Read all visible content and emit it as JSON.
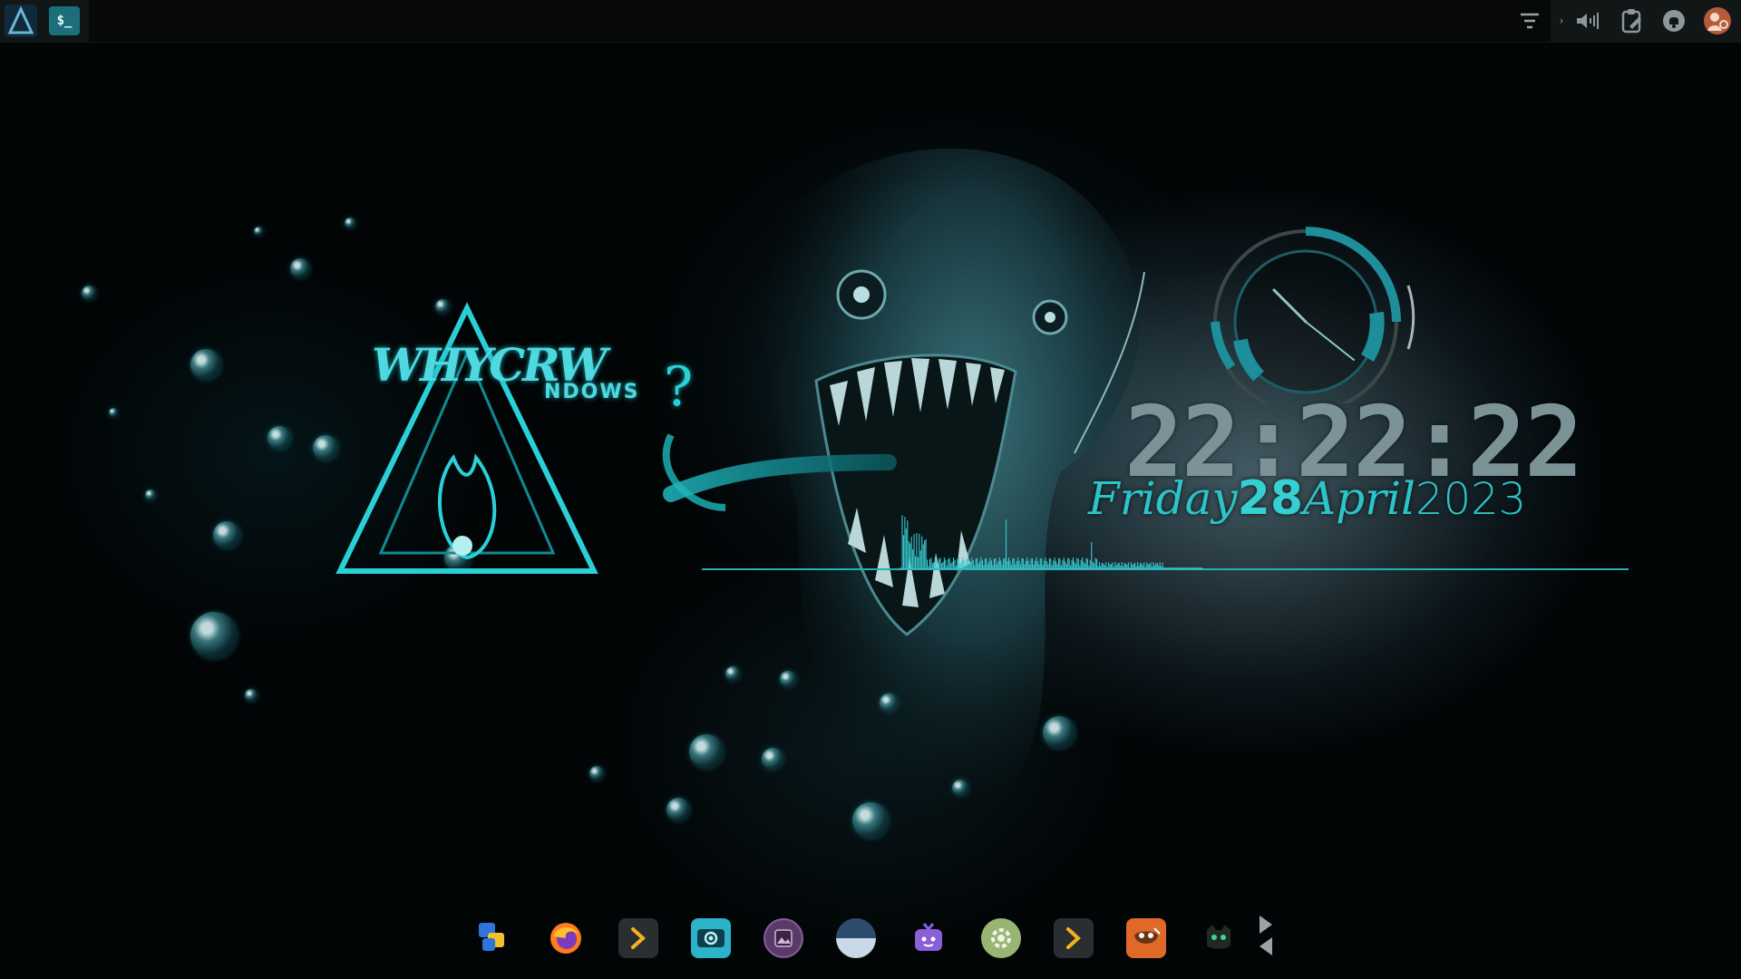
{
  "top_panel": {
    "launcher": {
      "icon": "arch-logo-icon"
    },
    "terminal": {
      "icon": "terminal-icon",
      "glyph": "$_"
    },
    "tray": [
      {
        "name": "notification-filter-icon"
      },
      {
        "name": "expand-tray-icon"
      },
      {
        "name": "volume-icon"
      },
      {
        "name": "clipboard-icon"
      },
      {
        "name": "notifications-bell-icon"
      },
      {
        "name": "user-avatar-icon"
      }
    ]
  },
  "wallpaper": {
    "logo_text_main": "WHY",
    "logo_text_mid": "CR",
    "logo_text_w": "W",
    "logo_text_rest": "NDOWS",
    "logo_question": "?"
  },
  "clock": {
    "time": "22:22:22",
    "day": "Friday",
    "day_number": "28",
    "month": "April",
    "year": "2023",
    "accent_color": "#2bc4c8"
  },
  "dock": {
    "items": [
      {
        "name": "fluent-reader-icon",
        "label": ""
      },
      {
        "name": "firefox-icon",
        "label": ""
      },
      {
        "name": "terminal-app-icon",
        "label": ""
      },
      {
        "name": "screenshot-app-icon",
        "label": ""
      },
      {
        "name": "image-viewer-icon",
        "label": ""
      },
      {
        "name": "weather-app-icon",
        "label": ""
      },
      {
        "name": "tv-app-icon",
        "label": ""
      },
      {
        "name": "settings-app-icon",
        "label": ""
      },
      {
        "name": "terminal-app-2-icon",
        "label": ""
      },
      {
        "name": "gimp-icon",
        "label": ""
      },
      {
        "name": "cat-app-icon",
        "label": ""
      }
    ]
  }
}
